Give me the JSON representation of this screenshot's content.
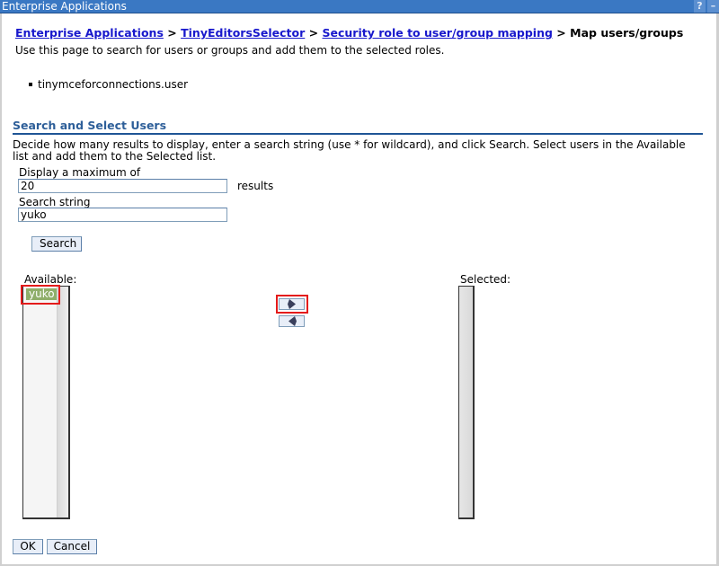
{
  "window": {
    "title": "Enterprise Applications",
    "help_label": "?",
    "minimize_label": "–"
  },
  "breadcrumb": {
    "items": [
      {
        "label": "Enterprise Applications",
        "link": true
      },
      {
        "label": "TinyEditorsSelector",
        "link": true
      },
      {
        "label": "Security role to user/group mapping",
        "link": true
      },
      {
        "label": "Map users/groups",
        "link": false
      }
    ],
    "separator": ">"
  },
  "page": {
    "description": "Use this page to search for users or groups and add them to the selected roles.",
    "roles": [
      "tinymceforconnections.user"
    ]
  },
  "search_section": {
    "title": "Search and Select Users",
    "instructions": "Decide how many results to display, enter a search string (use * for wildcard), and click Search. Select users in the Available list and add them to the Selected list.",
    "max_label": "Display a maximum of",
    "max_value": "20",
    "results_label": "results",
    "search_label": "Search string",
    "search_value": "yuko",
    "search_button": "Search"
  },
  "lists": {
    "available_label": "Available:",
    "available_items": [
      {
        "label": "yuko",
        "selected": true
      }
    ],
    "selected_label": "Selected:",
    "selected_items": [],
    "add_button_icon": "arrow-right-icon",
    "remove_button_icon": "arrow-left-icon"
  },
  "footer": {
    "ok_label": "OK",
    "cancel_label": "Cancel"
  },
  "colors": {
    "titlebar": "#3a78c3",
    "link": "#1818cc",
    "section_title": "#2e5f99",
    "selection": "#8fae6a",
    "highlight": "#e41b1b"
  }
}
